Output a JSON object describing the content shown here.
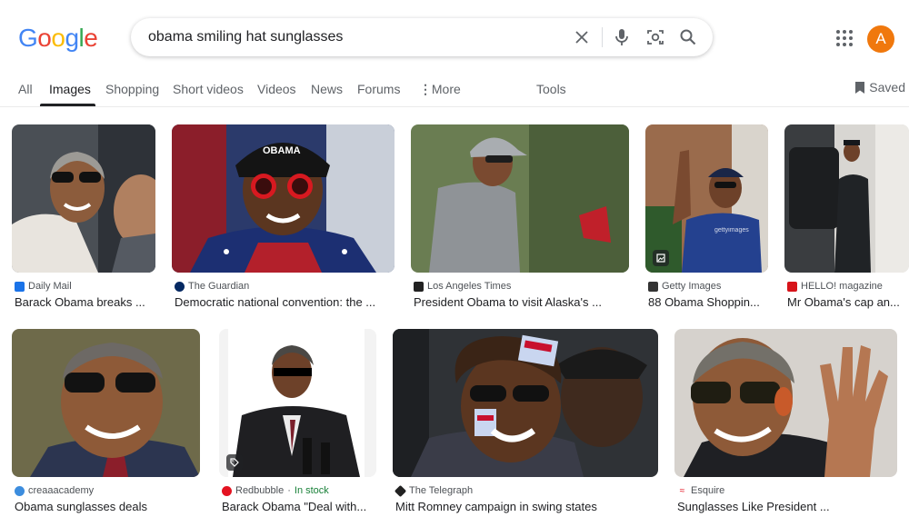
{
  "search": {
    "query": "obama smiling hat sunglasses"
  },
  "logo": {
    "letters": [
      "G",
      "o",
      "o",
      "g",
      "l",
      "e"
    ],
    "colors": [
      "#4285F4",
      "#EA4335",
      "#FBBC05",
      "#4285F4",
      "#34A853",
      "#EA4335"
    ]
  },
  "account": {
    "initial": "A",
    "color": "#f0780d"
  },
  "tabs": {
    "all": "All",
    "images": "Images",
    "shopping": "Shopping",
    "short_videos": "Short videos",
    "videos": "Videos",
    "news": "News",
    "forums": "Forums",
    "more": "More",
    "tools": "Tools",
    "saved": "Saved"
  },
  "results": [
    {
      "source": "Daily Mail",
      "title": "Barack Obama breaks ..."
    },
    {
      "source": "The Guardian",
      "title": "Democratic national convention: the ..."
    },
    {
      "source": "Los Angeles Times",
      "title": "President Obama to visit Alaska's ..."
    },
    {
      "source": "Getty Images",
      "title": "88 Obama Shoppin..."
    },
    {
      "source": "HELLO! magazine",
      "title": "Mr Obama's cap an..."
    },
    {
      "source": "creaaacademy",
      "title": "Obama sunglasses deals"
    },
    {
      "source": "Redbubble",
      "stock": "In stock",
      "title": "Barack Obama \"Deal with..."
    },
    {
      "source": "The Telegraph",
      "title": "Mitt Romney campaign in swing states"
    },
    {
      "source": "Esquire",
      "title": "Sunglasses Like President ..."
    }
  ]
}
